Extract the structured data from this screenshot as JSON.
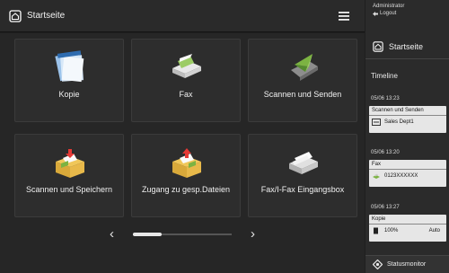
{
  "header": {
    "title": "Startseite"
  },
  "tiles": [
    {
      "label": "Kopie",
      "icon": "copy-icon"
    },
    {
      "label": "Fax",
      "icon": "fax-icon"
    },
    {
      "label": "Scannen und Senden",
      "icon": "scan-send-icon"
    },
    {
      "label": "Scannen und Speichern",
      "icon": "scan-store-icon"
    },
    {
      "label": "Zugang zu gesp.Dateien",
      "icon": "stored-files-icon"
    },
    {
      "label": "Fax/I-Fax Eingangsbox",
      "icon": "fax-inbox-icon"
    }
  ],
  "pager": {
    "prev": "‹",
    "next": "›"
  },
  "sidebar": {
    "user_line1": "Administrator",
    "user_line2": "Logout",
    "home_label": "Startseite",
    "timeline_title": "Timeline",
    "timeline": [
      {
        "time": "05/06 13:23",
        "type": "Scannen und Senden",
        "detail": "Sales Dept1",
        "extra": ""
      },
      {
        "time": "05/06 13:20",
        "type": "Fax",
        "detail": "0123XXXXXX",
        "extra": ""
      },
      {
        "time": "05/06 13:27",
        "type": "Kopie",
        "detail": "100%",
        "extra": "Auto"
      }
    ],
    "status_label": "Statusmonitor"
  },
  "colors": {
    "background": "#1f1f1f",
    "tile": "#2d2d2d",
    "sidebar": "#2b2b2b"
  }
}
